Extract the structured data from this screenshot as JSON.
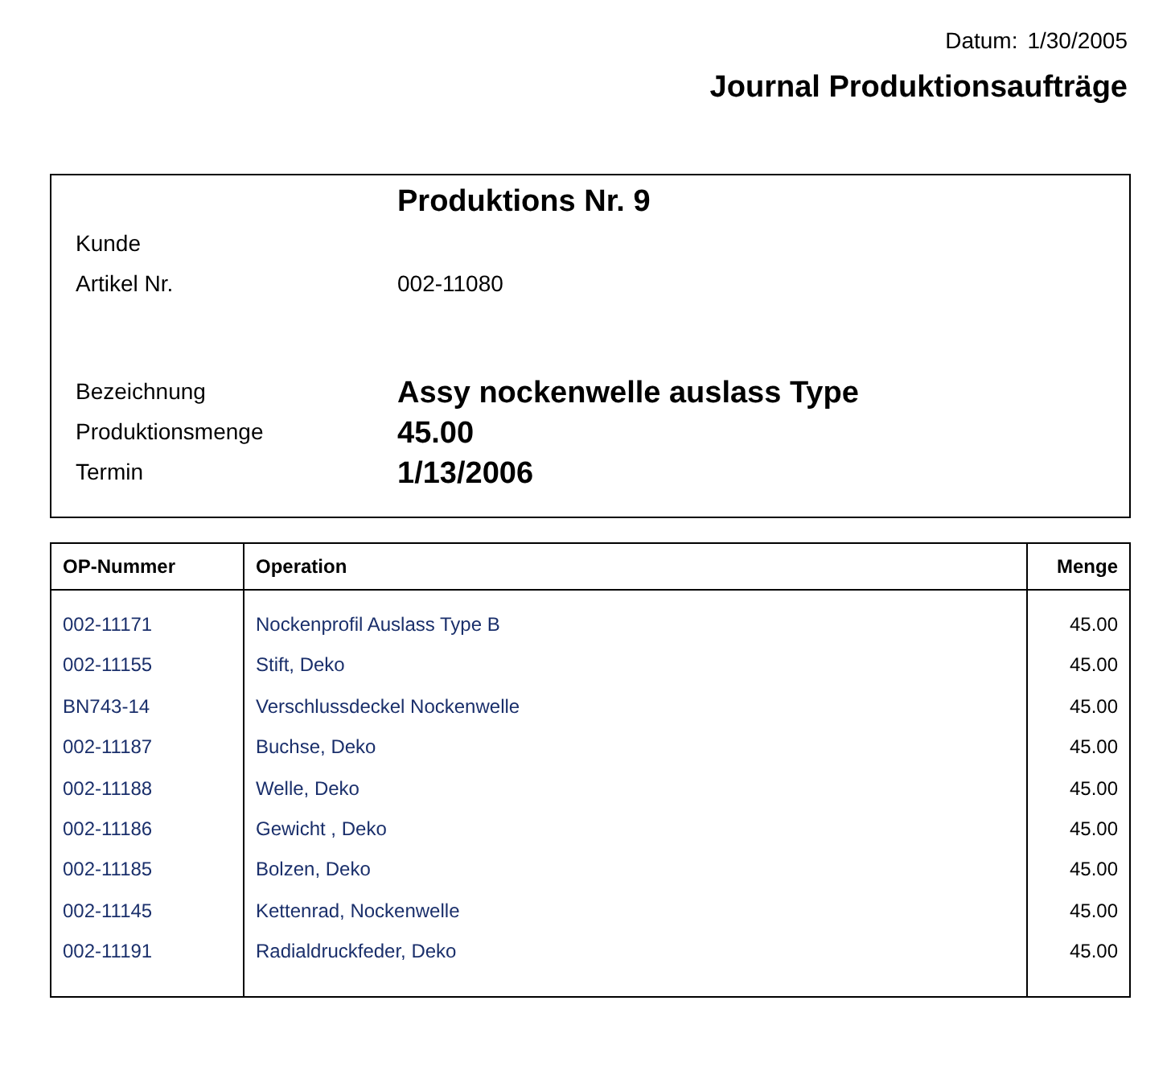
{
  "header": {
    "date_label": "Datum:",
    "date": "1/30/2005",
    "title": "Journal Produktionsaufträge"
  },
  "order": {
    "title": "Produktions Nr. 9",
    "fields": [
      {
        "label": "Kunde"
      },
      {
        "label": "Artikel Nr.",
        "value": "002-11080"
      }
    ],
    "details": [
      {
        "label": "Bezeichnung",
        "value": "Assy nockenwelle auslass Type"
      },
      {
        "label": "Produktionsmenge",
        "value": "45.00"
      },
      {
        "label": "Termin",
        "value": "1/13/2006"
      }
    ]
  },
  "table": {
    "columns": [
      "OP-Nummer",
      "Operation",
      "Menge"
    ],
    "rows": [
      {
        "op_number": "002-11171",
        "operation": "Nockenprofil Auslass Type B",
        "quantity": "45.00"
      },
      {
        "op_number": "002-11155",
        "operation": "Stift, Deko",
        "quantity": "45.00"
      },
      {
        "op_number": "BN743-14",
        "operation": "Verschlussdeckel Nockenwelle",
        "quantity": "45.00"
      },
      {
        "op_number": "002-11187",
        "operation": "Buchse, Deko",
        "quantity": "45.00"
      },
      {
        "op_number": "002-11188",
        "operation": "Welle, Deko",
        "quantity": "45.00"
      },
      {
        "op_number": "002-11186",
        "operation": "Gewicht , Deko",
        "quantity": "45.00"
      },
      {
        "op_number": "002-11185",
        "operation": "Bolzen, Deko",
        "quantity": "45.00"
      },
      {
        "op_number": "002-11145",
        "operation": "Kettenrad, Nockenwelle",
        "quantity": "45.00"
      },
      {
        "op_number": "002-11191",
        "operation": "Radialdruckfeder, Deko",
        "quantity": "45.00"
      }
    ]
  }
}
